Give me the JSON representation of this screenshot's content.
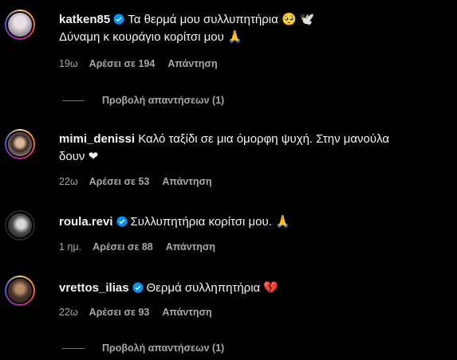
{
  "colors": {
    "background": "#000000",
    "text": "#f5f5f5",
    "muted": "#a8a8a8",
    "verified": "#0095f6",
    "heart": "#e0245e"
  },
  "comments": [
    {
      "username": "katken85",
      "verified": true,
      "line1": "Τα θερμά μου συλλυπητήρια 🥺 🕊️",
      "line2": "Δύναμη κ κουράγιο κορίτσι μου 🙏",
      "time": "19ω",
      "likes": "Αρέσει σε 194",
      "reply": "Απάντηση",
      "view_replies": "Προβολή απαντήσεων (1)"
    },
    {
      "username": "mimi_denissi",
      "verified": false,
      "line1": "Καλό ταξίδι σε μια όμορφη ψυχή. Στην μανούλα",
      "line2": "δουν ❤",
      "time": "22ω",
      "likes": "Αρέσει σε 53",
      "reply": "Απάντηση"
    },
    {
      "username": "roula.revi",
      "verified": true,
      "line1": "Συλλυπητήρια κορίτσι μου. 🙏",
      "time": "1 ημ.",
      "likes": "Αρέσει σε 88",
      "reply": "Απάντηση"
    },
    {
      "username": "vrettos_ilias",
      "verified": true,
      "line1": "Θερμά συλληπητήρια 💔",
      "time": "22ω",
      "likes": "Αρέσει σε 93",
      "reply": "Απάντηση",
      "view_replies": "Προβολή απαντήσεων (1)"
    }
  ]
}
